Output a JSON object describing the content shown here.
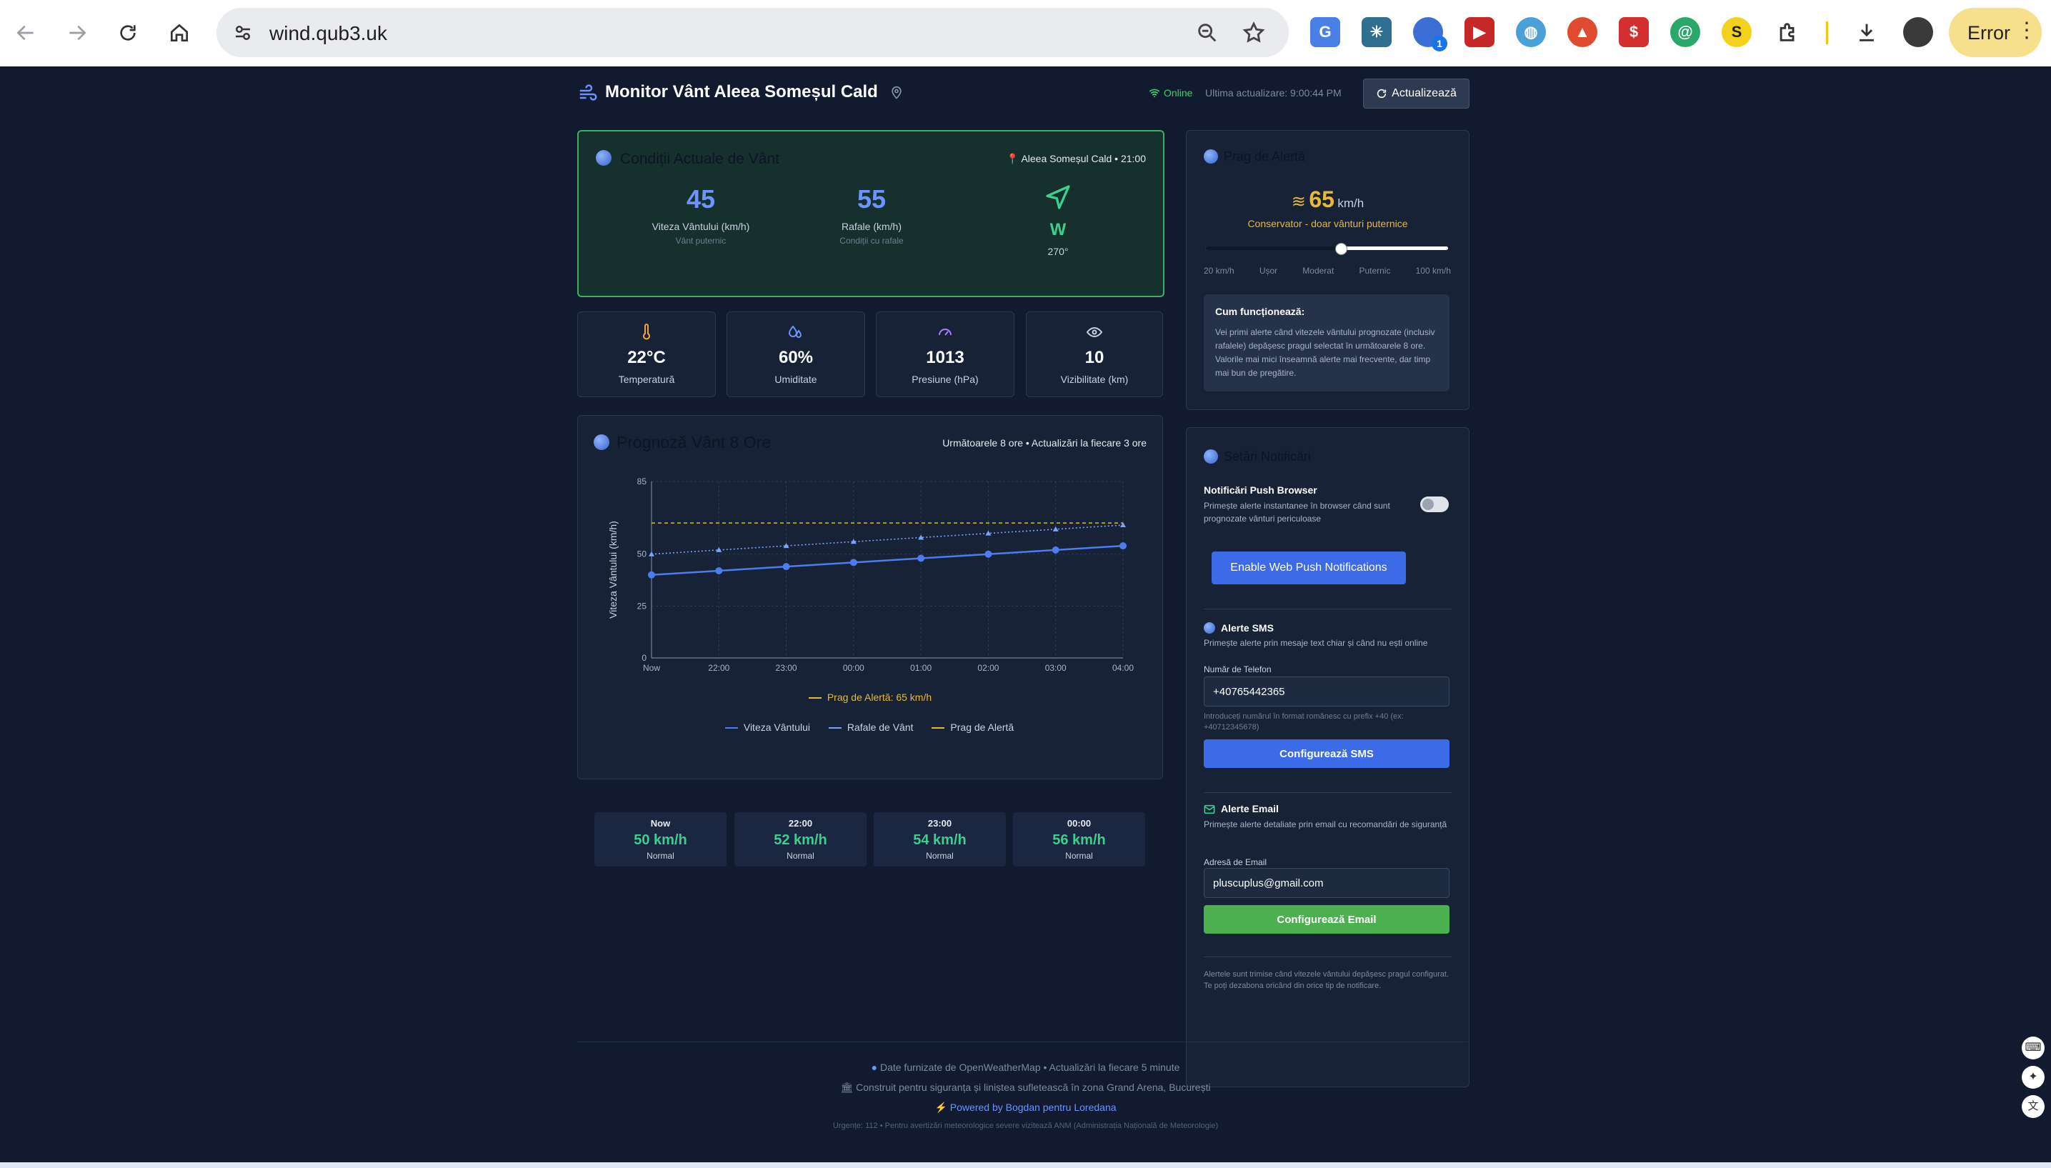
{
  "browser": {
    "url": "wind.qub3.uk",
    "error_label": "Error",
    "ext_badge": "1"
  },
  "header": {
    "title": "Monitor Vânt Aleea Someșul Cald",
    "status": "Online",
    "last_update": "Ultima actualizare: 9:00:44 PM",
    "refresh_label": "Actualizează"
  },
  "current": {
    "title": "Condiții Actuale de Vânt",
    "location": "Aleea Someșul Cald • 21:00",
    "wind_speed": "45",
    "wind_speed_label": "Viteza Vântului (km/h)",
    "wind_speed_sub": "Vânt puternic",
    "gusts": "55",
    "gusts_label": "Rafale (km/h)",
    "gusts_sub": "Condiții cu rafale",
    "direction": "W",
    "direction_deg": "270°"
  },
  "tiles": [
    {
      "value": "22°C",
      "label": "Temperatură"
    },
    {
      "value": "60%",
      "label": "Umiditate"
    },
    {
      "value": "1013",
      "label": "Presiune (hPa)"
    },
    {
      "value": "10",
      "label": "Vizibilitate (km)"
    }
  ],
  "forecast": {
    "title": "Prognoză Vânt 8 Ore",
    "subtitle": "Următoarele 8 ore • Actualizări la fiecare 3 ore",
    "threshold_note": "Prag de Alertă: 65 km/h",
    "legend": [
      "Viteza Vântului",
      "Rafale de Vânt",
      "Prag de Alertă"
    ],
    "cards": [
      {
        "time": "Now",
        "speed": "50 km/h",
        "status": "Normal"
      },
      {
        "time": "22:00",
        "speed": "52 km/h",
        "status": "Normal"
      },
      {
        "time": "23:00",
        "speed": "54 km/h",
        "status": "Normal"
      },
      {
        "time": "00:00",
        "speed": "56 km/h",
        "status": "Normal"
      }
    ]
  },
  "chart_data": {
    "type": "line",
    "categories": [
      "Now",
      "22:00",
      "23:00",
      "00:00",
      "01:00",
      "02:00",
      "03:00",
      "04:00"
    ],
    "series": [
      {
        "name": "Viteza Vântului",
        "values": [
          40,
          42,
          44,
          46,
          48,
          50,
          52,
          54
        ],
        "color": "#4d7cf0",
        "style": "solid"
      },
      {
        "name": "Rafale de Vânt",
        "values": [
          50,
          52,
          54,
          56,
          58,
          60,
          62,
          64
        ],
        "color": "#7aa2ff",
        "style": "dotted"
      },
      {
        "name": "Prag de Alertă",
        "values": [
          65,
          65,
          65,
          65,
          65,
          65,
          65,
          65
        ],
        "color": "#e6b93a",
        "style": "dashed"
      }
    ],
    "ylabel": "Viteza Vântului (km/h)",
    "xlabel": "",
    "ylim": [
      0,
      85
    ],
    "yticks": [
      0,
      25,
      50,
      85
    ],
    "grid": true
  },
  "threshold": {
    "title": "Prag de Alertă",
    "value": "65",
    "unit": "km/h",
    "description": "Conservator - doar vânturi puternice",
    "slider_fraction": 0.56,
    "scale_labels": [
      "20 km/h",
      "Ușor",
      "Moderat",
      "Puternic",
      "100 km/h"
    ],
    "how_title": "Cum funcționează:",
    "how_text": "Vei primi alerte când vitezele vântului prognozate (inclusiv rafalele) depășesc pragul selectat în următoarele 8 ore. Valorile mai mici înseamnă alerte mai frecvente, dar timp mai bun de pregătire."
  },
  "notifications": {
    "title": "Setări Notificări",
    "push_title": "Notificări Push Browser",
    "push_desc": "Primește alerte instantanee în browser când sunt prognozate vânturi periculoase",
    "push_button": "Enable Web Push Notifications",
    "sms_title": "Alerte SMS",
    "sms_desc": "Primește alerte prin mesaje text chiar și când nu ești online",
    "phone_label": "Număr de Telefon",
    "phone_value": "+40765442365",
    "phone_hint": "Introduceți numărul în format românesc cu prefix +40 (ex: +40712345678)",
    "sms_button": "Configurează SMS",
    "email_title": "Alerte Email",
    "email_desc": "Primește alerte detaliate prin email cu recomandări de siguranță",
    "email_label": "Adresă de Email",
    "email_value": "pluscuplus@gmail.com",
    "email_button": "Configurează Email",
    "footer_note": "Alertele sunt trimise când vitezele vântului depășesc pragul configurat. Te poți dezabona oricând din orice tip de notificare."
  },
  "footer": {
    "line1": "Date furnizate de OpenWeatherMap • Actualizări la fiecare 5 minute",
    "line2": "Construit pentru siguranța și liniștea sufletească în zona Grand Arena, București",
    "line3": "Powered by Bogdan pentru Loredana",
    "line4": "Urgențe: 112 • Pentru avertizări meteorologice severe vizitează ANM (Administrația Națională de Meteorologie)"
  },
  "colors": {
    "accent_blue": "#4d7cf0",
    "accent_green": "#4caf50",
    "threshold_yellow": "#e6b93a",
    "speed_green": "#3ecf8e"
  }
}
